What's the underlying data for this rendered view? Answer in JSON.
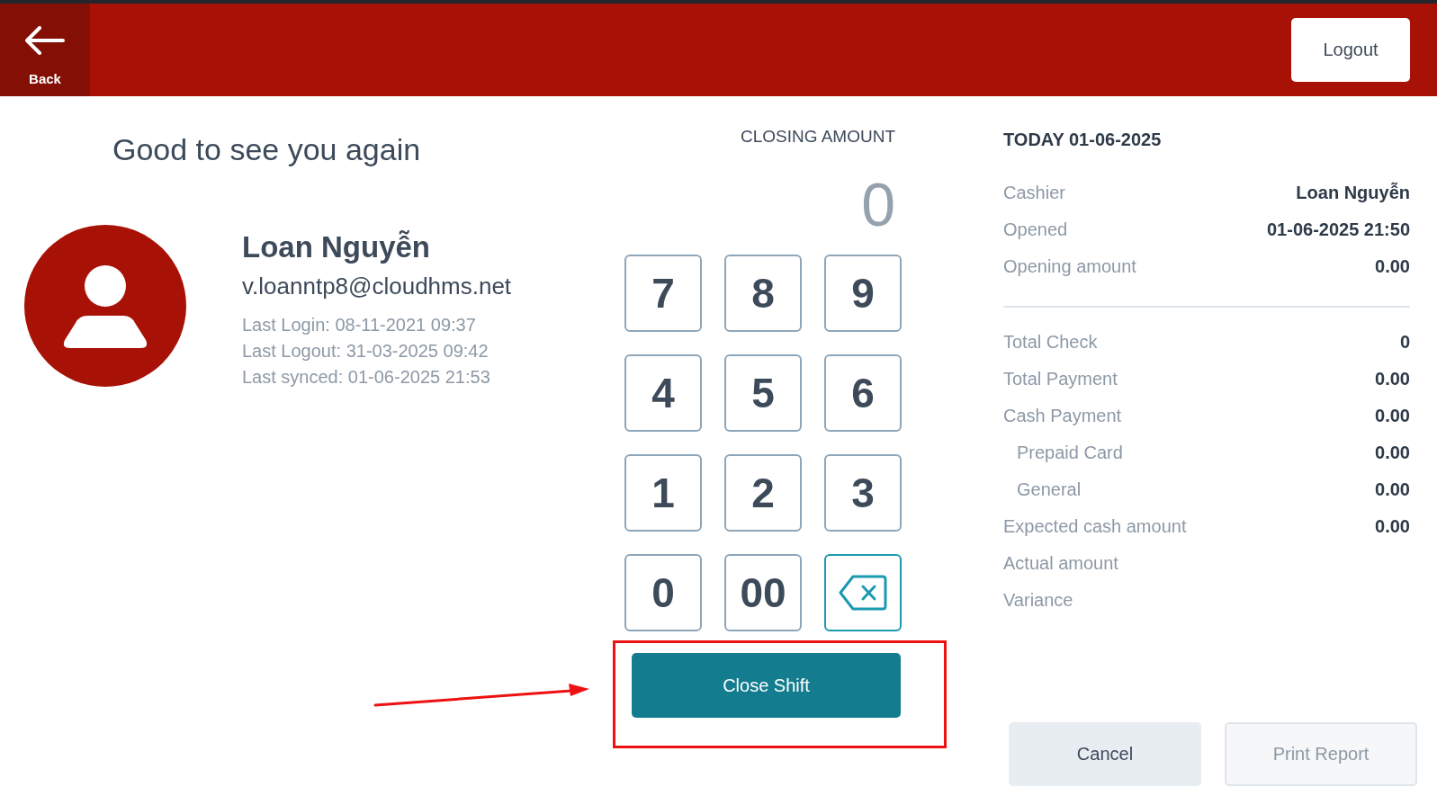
{
  "header": {
    "back_label": "Back",
    "logout_label": "Logout"
  },
  "greeting": "Good to see you again",
  "profile": {
    "name": "Loan Nguyễn",
    "email": "v.loanntp8@cloudhms.net",
    "details": [
      "Last Login: 08-11-2021 09:37",
      "Last Logout: 31-03-2025 09:42",
      "Last synced: 01-06-2025 21:53"
    ]
  },
  "closing_amount": {
    "label": "CLOSING AMOUNT",
    "placeholder": "0"
  },
  "keypad": {
    "keys": [
      {
        "kind": "digit",
        "label": "7"
      },
      {
        "kind": "digit",
        "label": "8"
      },
      {
        "kind": "digit",
        "label": "9"
      },
      {
        "kind": "digit",
        "label": "4"
      },
      {
        "kind": "digit",
        "label": "5"
      },
      {
        "kind": "digit",
        "label": "6"
      },
      {
        "kind": "digit",
        "label": "1"
      },
      {
        "kind": "digit",
        "label": "2"
      },
      {
        "kind": "digit",
        "label": "3"
      },
      {
        "kind": "digit",
        "label": "0"
      },
      {
        "kind": "digit",
        "label": "00"
      },
      {
        "kind": "backspace"
      }
    ]
  },
  "close_shift_button": "Close Shift",
  "summary": {
    "title": "TODAY 01-06-2025",
    "sections": [
      {
        "rows": [
          {
            "label": "Cashier",
            "value": "Loan Nguyễn"
          },
          {
            "label": "Opened",
            "value": "01-06-2025 21:50"
          },
          {
            "label": "Opening amount",
            "value": "0.00"
          }
        ]
      },
      {
        "rows": [
          {
            "label": "Total Check",
            "value": "0"
          },
          {
            "label": "Total Payment",
            "value": "0.00"
          },
          {
            "label": "Cash Payment",
            "value": "0.00",
            "children": [
              {
                "label": "Prepaid Card",
                "value": "0.00"
              },
              {
                "label": "General",
                "value": "0.00"
              }
            ]
          },
          {
            "label": "Expected cash amount",
            "value": "0.00"
          },
          {
            "label": "Actual amount"
          },
          {
            "label": "Variance"
          }
        ]
      }
    ]
  },
  "actions": [
    {
      "label": "Cancel",
      "disabled": false
    },
    {
      "label": "Print Report",
      "disabled": true
    }
  ],
  "annotation": {
    "highlight_box": true,
    "arrow": true
  }
}
